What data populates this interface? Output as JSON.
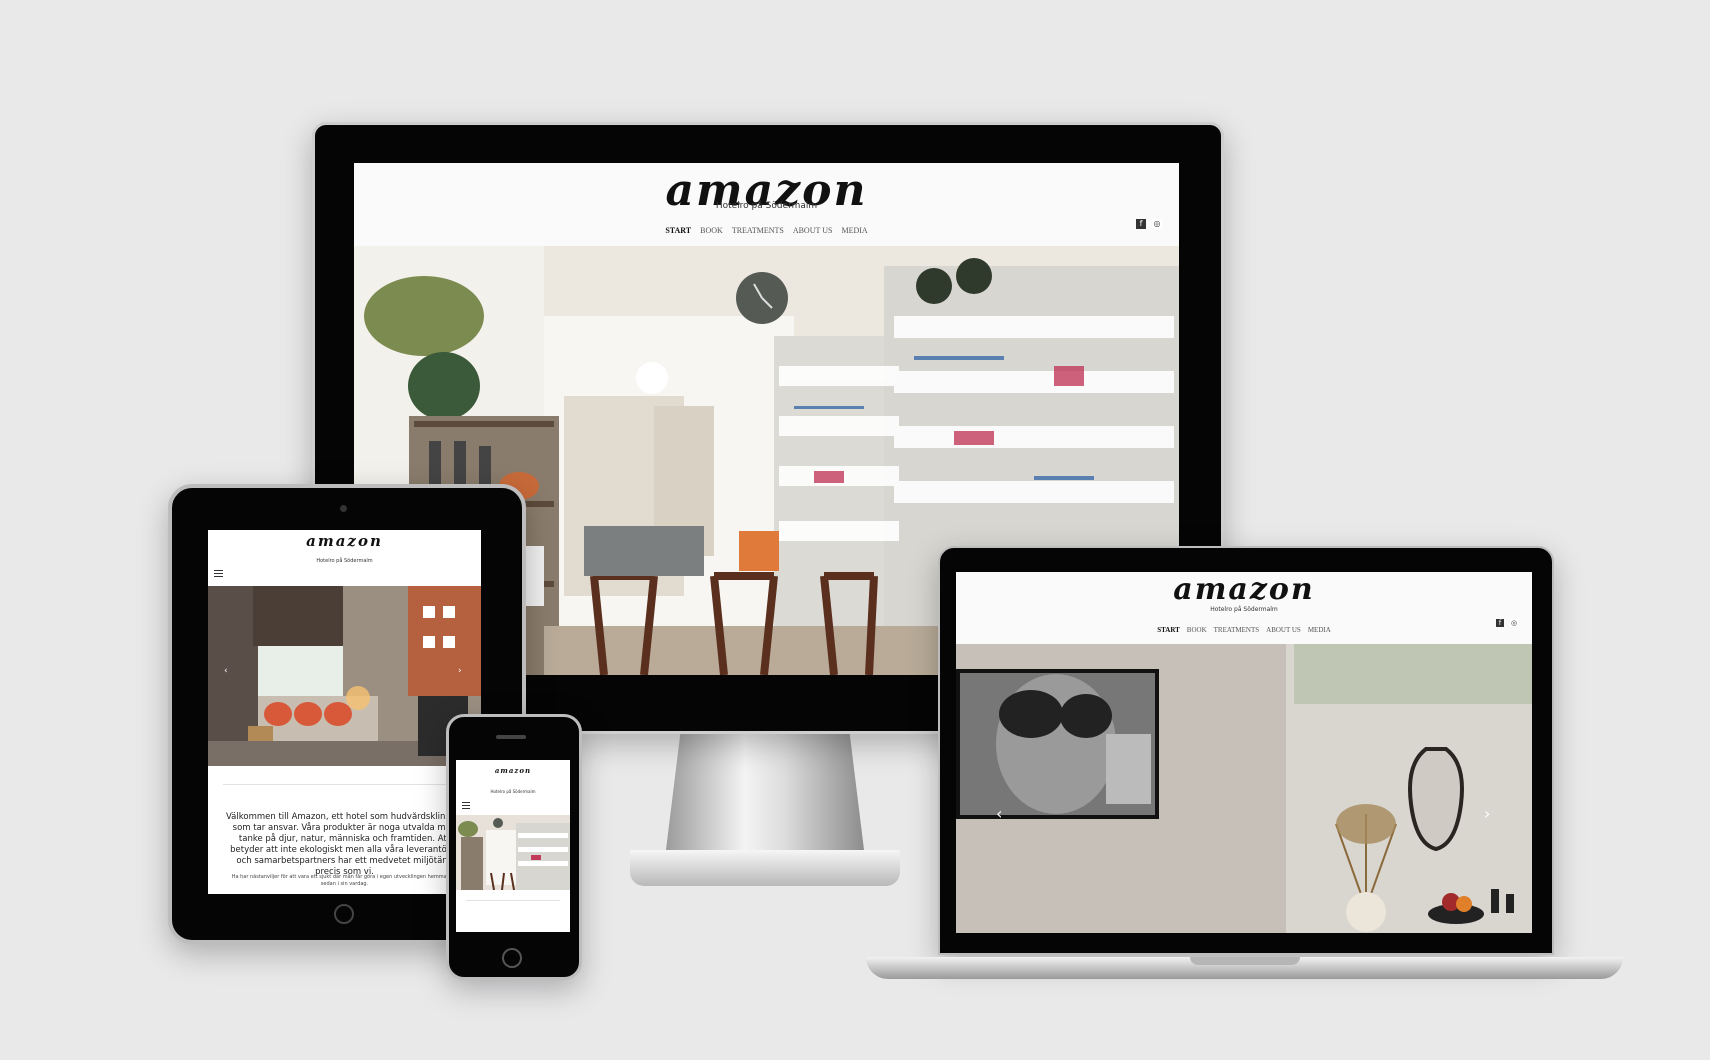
{
  "brand": {
    "logo": "amazon",
    "tagline": "Hotelro på Södermalm"
  },
  "nav": {
    "items": [
      "START",
      "BOOK",
      "TREATMENTS",
      "ABOUT US",
      "MEDIA"
    ],
    "active": "START"
  },
  "social": {
    "facebook_icon": "f",
    "instagram_icon": "◎"
  },
  "tablet": {
    "welcome_title": "Välkommen till Amazon, ett hotel som hudvårdskliniken som tar ansvar. Våra produkter är noga utvalda med tanke på djur, natur, människa och framtiden. Att betyder att inte ekologiskt men alla våra leverantörer och samarbetspartners har ett medvetet miljötänk precis som vi.",
    "welcome_small": "Ha har nästanviljer för att vara ett sjukt där mån får göra i egen utvecklingen hemma och sedan i sin vardag."
  },
  "slider": {
    "prev_arrow": "‹",
    "next_arrow": "›"
  },
  "icons": {
    "hamburger": "menu-icon",
    "facebook": "facebook-icon",
    "instagram": "instagram-icon"
  },
  "colors": {
    "bezel": "#050505",
    "background": "#e9e9ea",
    "screen": "#ffffff"
  }
}
